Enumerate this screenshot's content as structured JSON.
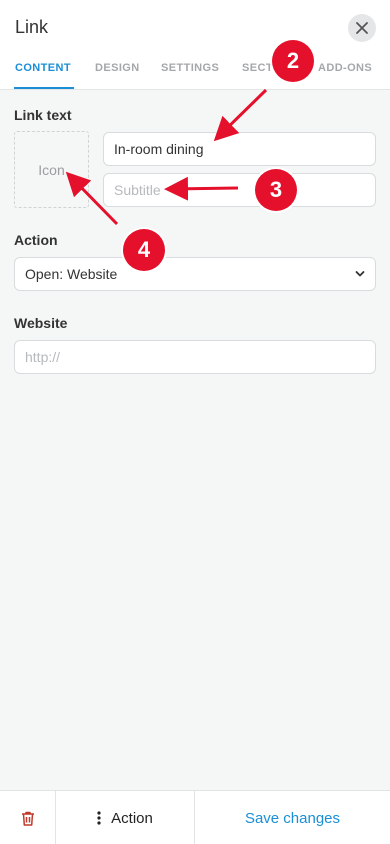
{
  "header": {
    "title": "Link",
    "close_icon": "close-icon"
  },
  "tabs": [
    {
      "label": "CONTENT",
      "active": true
    },
    {
      "label": "DESIGN",
      "active": false
    },
    {
      "label": "SETTINGS",
      "active": false
    },
    {
      "label": "SECT",
      "active": false
    },
    {
      "label": "ADD-ONS",
      "active": false
    }
  ],
  "content": {
    "link_text_label": "Link text",
    "icon_placeholder": "Icon",
    "link_text_value": "In-room dining",
    "subtitle_placeholder": "Subtitle",
    "action_label": "Action",
    "action_selected": "Open: Website",
    "website_label": "Website",
    "website_placeholder": "http://"
  },
  "footer": {
    "delete_icon": "trash-icon",
    "action_label": "Action",
    "save_label": "Save changes"
  },
  "annotations": [
    {
      "number": "2",
      "color": "#e5102b"
    },
    {
      "number": "3",
      "color": "#e5102b"
    },
    {
      "number": "4",
      "color": "#e5102b"
    }
  ],
  "colors": {
    "accent": "#1a8fd6",
    "danger": "#c0392b",
    "annotation": "#e5102b",
    "background": "#f5f6f6"
  }
}
